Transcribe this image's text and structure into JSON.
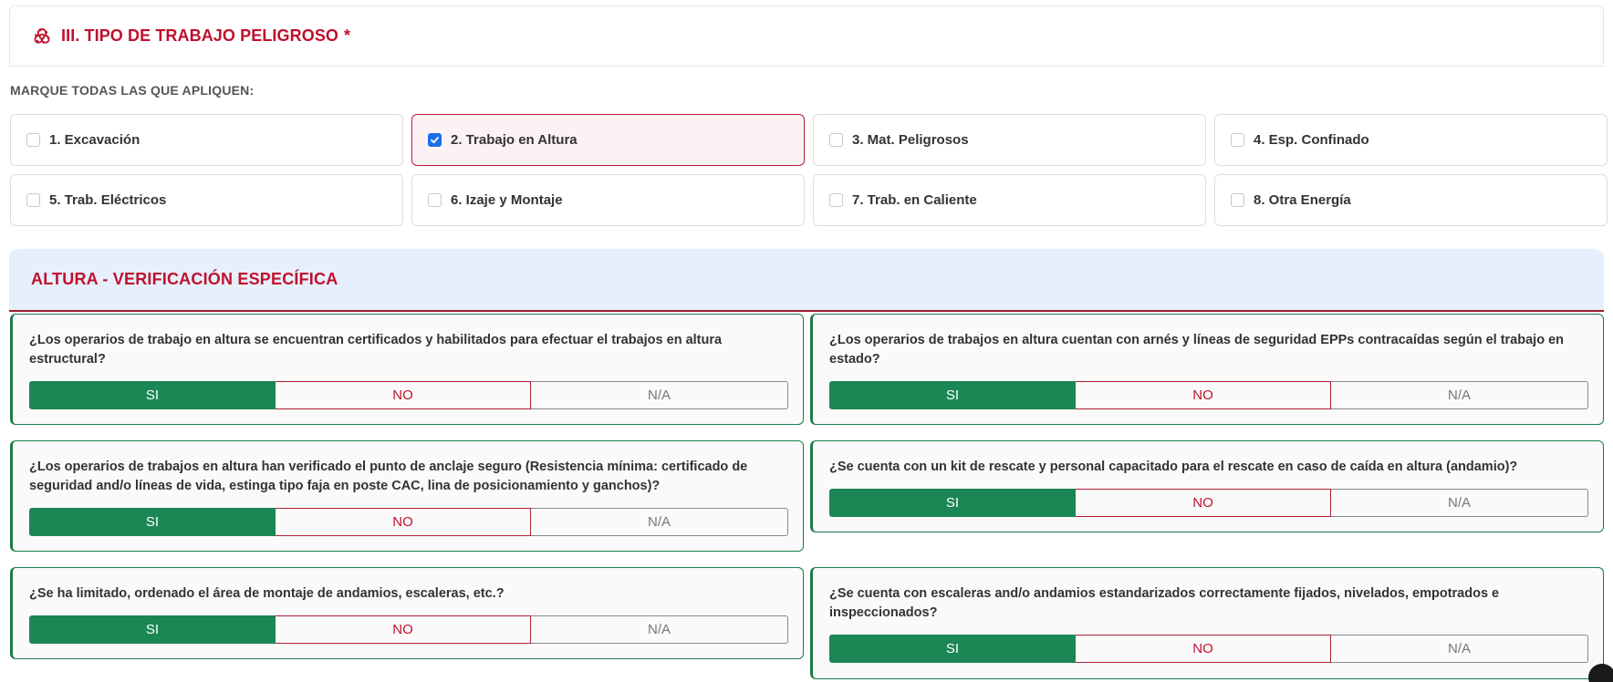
{
  "section": {
    "icon": "biohazard-icon",
    "title": "III. TIPO DE TRABAJO PELIGROSO",
    "required_marker": "*",
    "instruction": "MARQUE TODAS LAS QUE APLIQUEN:"
  },
  "work_types": [
    {
      "label": "1. Excavación",
      "checked": false
    },
    {
      "label": "2. Trabajo en Altura",
      "checked": true
    },
    {
      "label": "3. Mat. Peligrosos",
      "checked": false
    },
    {
      "label": "4. Esp. Confinado",
      "checked": false
    },
    {
      "label": "5. Trab. Eléctricos",
      "checked": false
    },
    {
      "label": "6. Izaje y Montaje",
      "checked": false
    },
    {
      "label": "7. Trab. en Caliente",
      "checked": false
    },
    {
      "label": "8. Otra Energía",
      "checked": false
    }
  ],
  "altura": {
    "title": "ALTURA - VERIFICACIÓN ESPECÍFICA",
    "options": {
      "si": "SI",
      "no": "NO",
      "na": "N/A"
    },
    "questions": [
      {
        "text": "¿Los operarios de trabajo en altura se encuentran certificados y habilitados para efectuar el trabajos en altura estructural?",
        "selected": "SI"
      },
      {
        "text": "¿Los operarios de trabajos en altura cuentan con arnés y líneas de seguridad EPPs contracaídas según el trabajo en estado?",
        "selected": "SI"
      },
      {
        "text": "¿Los operarios de trabajos en altura han verificado el punto de anclaje seguro (Resistencia mínima: certificado de seguridad and/o líneas de vida, estinga tipo faja en poste CAC, lina de posicionamiento y ganchos)?",
        "selected": "SI"
      },
      {
        "text": "¿Se cuenta con un kit de rescate y personal capacitado para el rescate en caso de caída en altura (andamio)?",
        "selected": "SI"
      },
      {
        "text": "¿Se ha limitado, ordenado el área de montaje de andamios, escaleras, etc.?",
        "selected": "SI"
      },
      {
        "text": "¿Se cuenta con escaleras and/o andamios estandarizados correctamente fijados, nivelados, empotrados e inspeccionados?",
        "selected": "SI"
      }
    ]
  },
  "colors": {
    "accent_red": "#c0102c",
    "si_green": "#1b8754",
    "checkbox_blue": "#1a6fe8",
    "altura_bg": "#e6effc"
  }
}
